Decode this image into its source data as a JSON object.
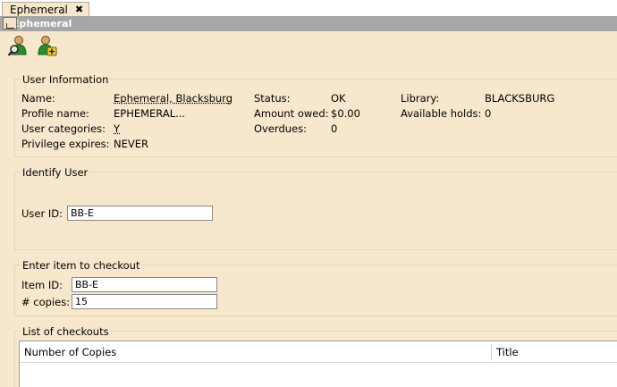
{
  "tab": {
    "label": "Ephemeral",
    "close": "✖"
  },
  "caption": {
    "title": "Ephemeral"
  },
  "toolbar": {
    "lookup_icon": "user-search-icon",
    "add_icon": "user-add-icon"
  },
  "user_info": {
    "title": "User Information",
    "name_label": "Name:",
    "name_value": "Ephemeral, Blacksburg",
    "profile_label": "Profile name:",
    "profile_value": "EPHEMERAL...",
    "categories_label": "User categories:",
    "categories_value": "Y",
    "privilege_label": "Privilege expires:",
    "privilege_value": "NEVER",
    "status_label": "Status:",
    "status_value": "OK",
    "amount_label": "Amount owed:",
    "amount_value": "$0.00",
    "overdues_label": "Overdues:",
    "overdues_value": "0",
    "library_label": "Library:",
    "library_value": "BLACKSBURG",
    "holds_label": "Available holds:",
    "holds_value": "0"
  },
  "identify_user": {
    "title": "Identify User",
    "userid_label": "User ID:",
    "userid_value": "BB-E"
  },
  "checkout": {
    "title": "Enter item to checkout",
    "itemid_label": "Item ID:",
    "itemid_value": "BB-E",
    "copies_label": "# copies:",
    "copies_value": "15"
  },
  "checkouts_list": {
    "title": "List of checkouts",
    "columns": [
      "Number of Copies",
      "Title"
    ]
  }
}
